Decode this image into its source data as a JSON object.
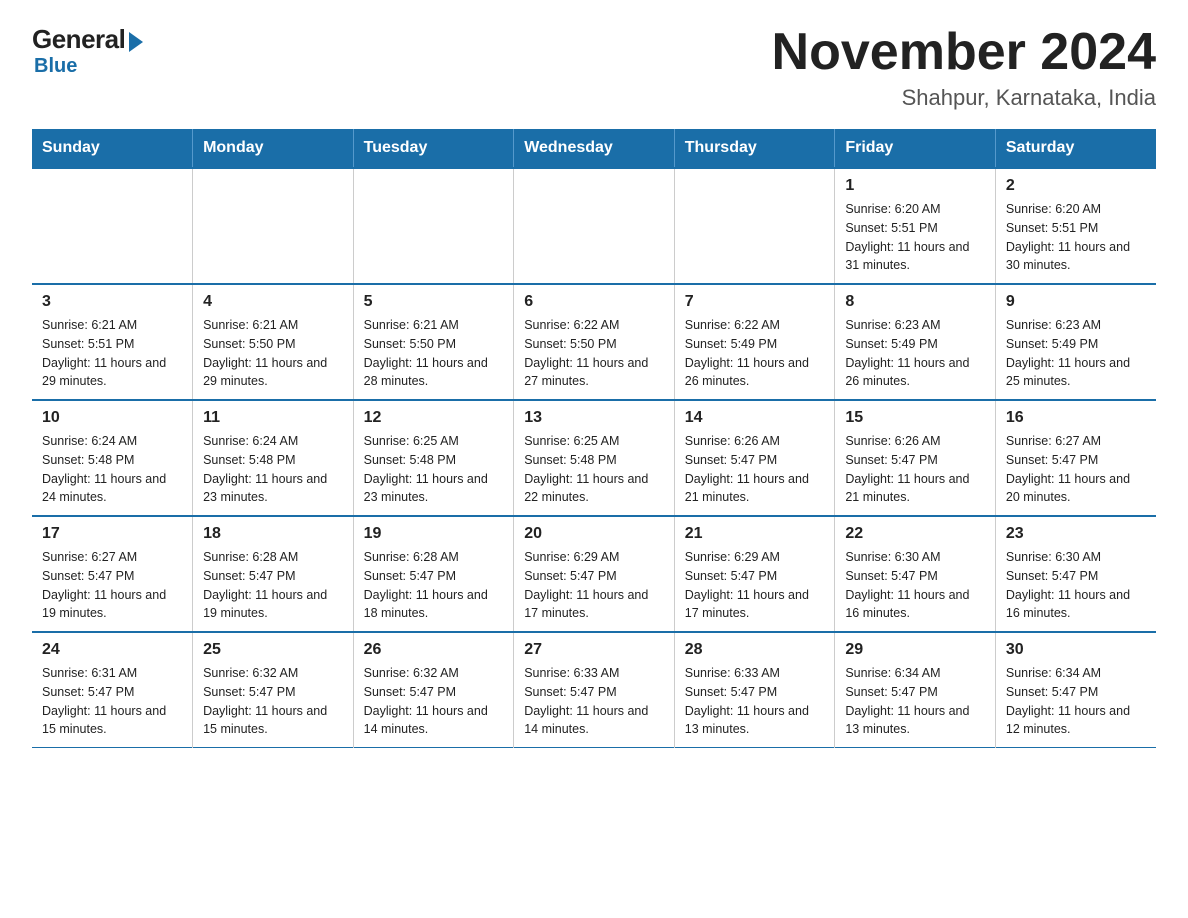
{
  "header": {
    "logo_general": "General",
    "logo_blue": "Blue",
    "title": "November 2024",
    "location": "Shahpur, Karnataka, India"
  },
  "weekdays": [
    "Sunday",
    "Monday",
    "Tuesday",
    "Wednesday",
    "Thursday",
    "Friday",
    "Saturday"
  ],
  "weeks": [
    [
      {
        "day": "",
        "info": ""
      },
      {
        "day": "",
        "info": ""
      },
      {
        "day": "",
        "info": ""
      },
      {
        "day": "",
        "info": ""
      },
      {
        "day": "",
        "info": ""
      },
      {
        "day": "1",
        "info": "Sunrise: 6:20 AM\nSunset: 5:51 PM\nDaylight: 11 hours and 31 minutes."
      },
      {
        "day": "2",
        "info": "Sunrise: 6:20 AM\nSunset: 5:51 PM\nDaylight: 11 hours and 30 minutes."
      }
    ],
    [
      {
        "day": "3",
        "info": "Sunrise: 6:21 AM\nSunset: 5:51 PM\nDaylight: 11 hours and 29 minutes."
      },
      {
        "day": "4",
        "info": "Sunrise: 6:21 AM\nSunset: 5:50 PM\nDaylight: 11 hours and 29 minutes."
      },
      {
        "day": "5",
        "info": "Sunrise: 6:21 AM\nSunset: 5:50 PM\nDaylight: 11 hours and 28 minutes."
      },
      {
        "day": "6",
        "info": "Sunrise: 6:22 AM\nSunset: 5:50 PM\nDaylight: 11 hours and 27 minutes."
      },
      {
        "day": "7",
        "info": "Sunrise: 6:22 AM\nSunset: 5:49 PM\nDaylight: 11 hours and 26 minutes."
      },
      {
        "day": "8",
        "info": "Sunrise: 6:23 AM\nSunset: 5:49 PM\nDaylight: 11 hours and 26 minutes."
      },
      {
        "day": "9",
        "info": "Sunrise: 6:23 AM\nSunset: 5:49 PM\nDaylight: 11 hours and 25 minutes."
      }
    ],
    [
      {
        "day": "10",
        "info": "Sunrise: 6:24 AM\nSunset: 5:48 PM\nDaylight: 11 hours and 24 minutes."
      },
      {
        "day": "11",
        "info": "Sunrise: 6:24 AM\nSunset: 5:48 PM\nDaylight: 11 hours and 23 minutes."
      },
      {
        "day": "12",
        "info": "Sunrise: 6:25 AM\nSunset: 5:48 PM\nDaylight: 11 hours and 23 minutes."
      },
      {
        "day": "13",
        "info": "Sunrise: 6:25 AM\nSunset: 5:48 PM\nDaylight: 11 hours and 22 minutes."
      },
      {
        "day": "14",
        "info": "Sunrise: 6:26 AM\nSunset: 5:47 PM\nDaylight: 11 hours and 21 minutes."
      },
      {
        "day": "15",
        "info": "Sunrise: 6:26 AM\nSunset: 5:47 PM\nDaylight: 11 hours and 21 minutes."
      },
      {
        "day": "16",
        "info": "Sunrise: 6:27 AM\nSunset: 5:47 PM\nDaylight: 11 hours and 20 minutes."
      }
    ],
    [
      {
        "day": "17",
        "info": "Sunrise: 6:27 AM\nSunset: 5:47 PM\nDaylight: 11 hours and 19 minutes."
      },
      {
        "day": "18",
        "info": "Sunrise: 6:28 AM\nSunset: 5:47 PM\nDaylight: 11 hours and 19 minutes."
      },
      {
        "day": "19",
        "info": "Sunrise: 6:28 AM\nSunset: 5:47 PM\nDaylight: 11 hours and 18 minutes."
      },
      {
        "day": "20",
        "info": "Sunrise: 6:29 AM\nSunset: 5:47 PM\nDaylight: 11 hours and 17 minutes."
      },
      {
        "day": "21",
        "info": "Sunrise: 6:29 AM\nSunset: 5:47 PM\nDaylight: 11 hours and 17 minutes."
      },
      {
        "day": "22",
        "info": "Sunrise: 6:30 AM\nSunset: 5:47 PM\nDaylight: 11 hours and 16 minutes."
      },
      {
        "day": "23",
        "info": "Sunrise: 6:30 AM\nSunset: 5:47 PM\nDaylight: 11 hours and 16 minutes."
      }
    ],
    [
      {
        "day": "24",
        "info": "Sunrise: 6:31 AM\nSunset: 5:47 PM\nDaylight: 11 hours and 15 minutes."
      },
      {
        "day": "25",
        "info": "Sunrise: 6:32 AM\nSunset: 5:47 PM\nDaylight: 11 hours and 15 minutes."
      },
      {
        "day": "26",
        "info": "Sunrise: 6:32 AM\nSunset: 5:47 PM\nDaylight: 11 hours and 14 minutes."
      },
      {
        "day": "27",
        "info": "Sunrise: 6:33 AM\nSunset: 5:47 PM\nDaylight: 11 hours and 14 minutes."
      },
      {
        "day": "28",
        "info": "Sunrise: 6:33 AM\nSunset: 5:47 PM\nDaylight: 11 hours and 13 minutes."
      },
      {
        "day": "29",
        "info": "Sunrise: 6:34 AM\nSunset: 5:47 PM\nDaylight: 11 hours and 13 minutes."
      },
      {
        "day": "30",
        "info": "Sunrise: 6:34 AM\nSunset: 5:47 PM\nDaylight: 11 hours and 12 minutes."
      }
    ]
  ]
}
